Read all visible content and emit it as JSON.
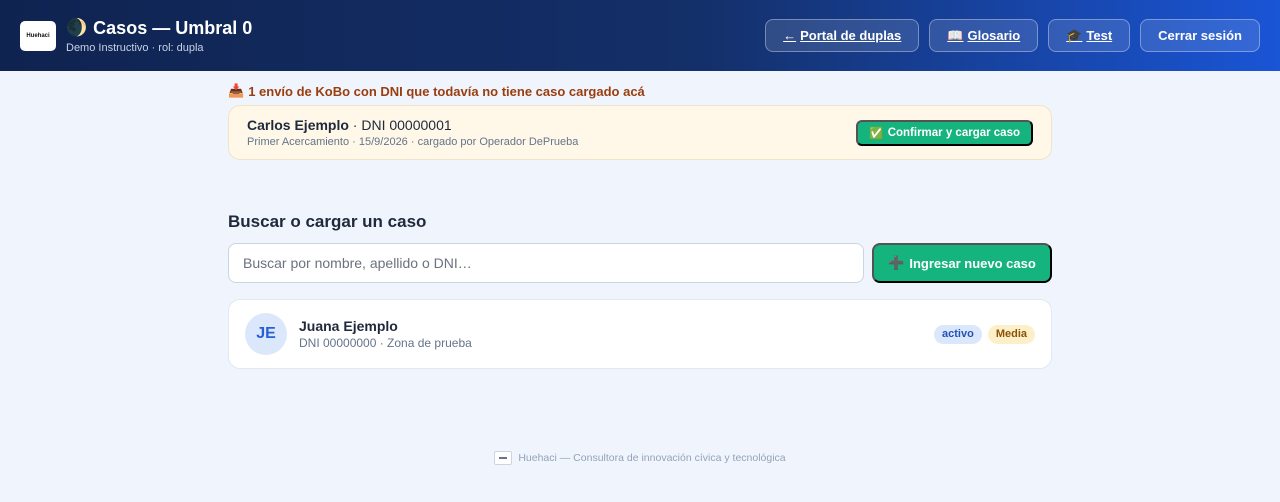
{
  "header": {
    "logo_text": "Huehaci",
    "moon_icon": "🌒",
    "title": "Casos — Umbral 0",
    "subtitle": "Demo Instructivo · rol: dupla",
    "nav": [
      {
        "icon": "←",
        "label": "Portal de duplas"
      },
      {
        "icon": "📖",
        "label": "Glosario"
      },
      {
        "icon": "🎓",
        "label": "Test"
      },
      {
        "label": "Cerrar sesión"
      }
    ]
  },
  "kobo": {
    "icon": "📥",
    "notice": "1 envío de KoBo con DNI que todavía no tiene caso cargado acá",
    "name": "Carlos Ejemplo",
    "dni": " · DNI 00000001",
    "meta": "Primer Acercamiento · 15/9/2026 · cargado por Operador DePrueba",
    "confirm_icon": "✅",
    "confirm_label": "Confirmar y cargar caso"
  },
  "search": {
    "section_title": "Buscar o cargar un caso",
    "placeholder": "Buscar por nombre, apellido o DNI…",
    "new_icon": "➕",
    "new_label": "Ingresar nuevo caso"
  },
  "cases": [
    {
      "initials": "JE",
      "name": "Juana Ejemplo",
      "meta": "DNI 00000000 · Zona de prueba",
      "status": "activo",
      "priority": "Media"
    }
  ],
  "footer": {
    "text": "Huehaci — Consultora de innovación cívica y tecnológica"
  },
  "colors": {
    "accent_green": "#15b37d",
    "header_start": "#0f2350",
    "header_end": "#1a55d6",
    "kobo_title": "#9a3d0f"
  }
}
